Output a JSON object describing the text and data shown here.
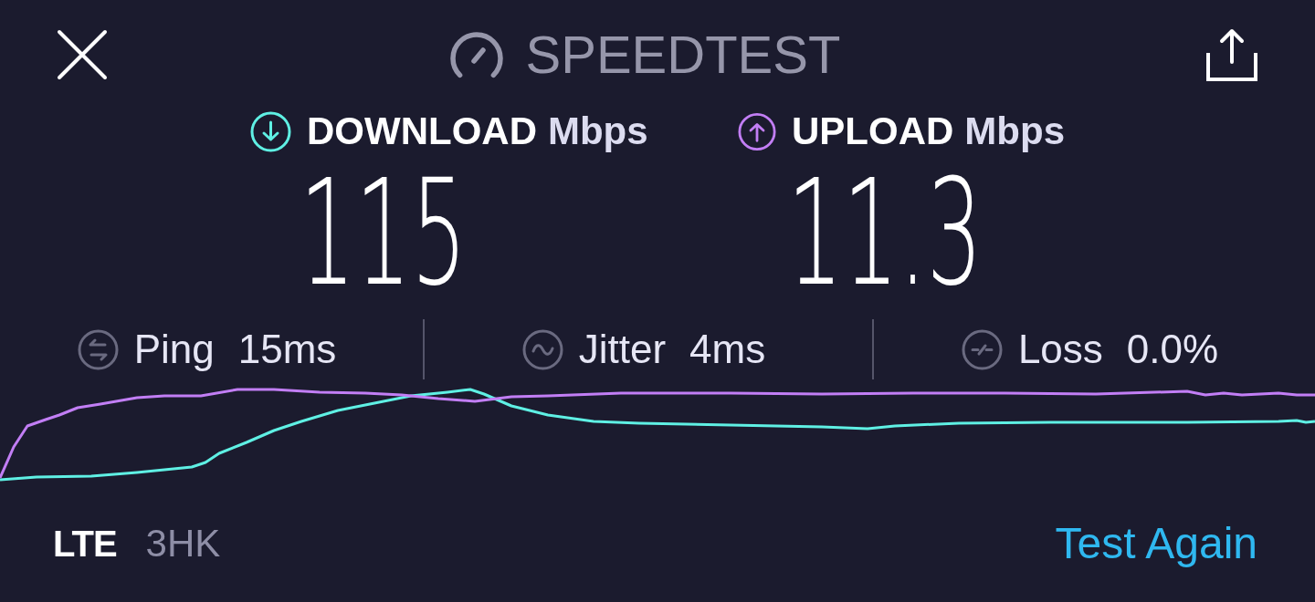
{
  "header": {
    "title": "SPEEDTEST"
  },
  "results": [
    {
      "kind": "download",
      "label": "DOWNLOAD",
      "unit": "Mbps",
      "value": "115",
      "color": "#5ff0e4"
    },
    {
      "kind": "upload",
      "label": "UPLOAD",
      "unit": "Mbps",
      "value": "11.3",
      "color": "#c27ef5"
    }
  ],
  "stats": [
    {
      "kind": "ping",
      "label": "Ping",
      "value": "15ms"
    },
    {
      "kind": "jitter",
      "label": "Jitter",
      "value": "4ms"
    },
    {
      "kind": "loss",
      "label": "Loss",
      "value": "0.0%"
    }
  ],
  "footer": {
    "network_type": "LTE",
    "carrier": "3HK",
    "action": "Test Again"
  }
}
